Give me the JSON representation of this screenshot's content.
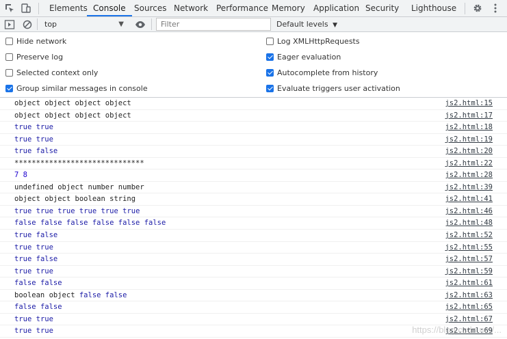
{
  "devtools": {
    "tabs": [
      {
        "label": "Elements"
      },
      {
        "label": "Console",
        "active": true
      },
      {
        "label": "Sources"
      },
      {
        "label": "Network"
      },
      {
        "label": "Performance"
      },
      {
        "label": "Memory"
      },
      {
        "label": "Application"
      },
      {
        "label": "Security"
      },
      {
        "label": "Lighthouse"
      }
    ],
    "accent_color": "#1a73e8"
  },
  "toolbar": {
    "context": "top",
    "filter_placeholder": "Filter",
    "levels_label": "Default levels"
  },
  "settings": {
    "left": [
      {
        "label": "Hide network",
        "checked": false
      },
      {
        "label": "Preserve log",
        "checked": false
      },
      {
        "label": "Selected context only",
        "checked": false
      },
      {
        "label": "Group similar messages in console",
        "checked": true
      }
    ],
    "right": [
      {
        "label": "Log XMLHttpRequests",
        "checked": false
      },
      {
        "label": "Eager evaluation",
        "checked": true
      },
      {
        "label": "Autocomplete from history",
        "checked": true
      },
      {
        "label": "Evaluate triggers user activation",
        "checked": true
      }
    ]
  },
  "console": {
    "messages": [
      {
        "text": "object object object object",
        "source": "js2.html:15"
      },
      {
        "text": "object object object object",
        "source": "js2.html:17"
      },
      {
        "text": "true true",
        "source": "js2.html:18"
      },
      {
        "text": "true true",
        "source": "js2.html:19"
      },
      {
        "text": "true false",
        "source": "js2.html:20"
      },
      {
        "text": "******************************",
        "source": "js2.html:22"
      },
      {
        "text": "7 8",
        "source": "js2.html:28"
      },
      {
        "text": "undefined object number number",
        "source": "js2.html:39"
      },
      {
        "text": "object object boolean string",
        "source": "js2.html:41"
      },
      {
        "text": "true true true true true true",
        "source": "js2.html:46"
      },
      {
        "text": "false false false false false false",
        "source": "js2.html:48"
      },
      {
        "text": "true false",
        "source": "js2.html:52"
      },
      {
        "text": "true true",
        "source": "js2.html:55"
      },
      {
        "text": "true false",
        "source": "js2.html:57"
      },
      {
        "text": "true true",
        "source": "js2.html:59"
      },
      {
        "text": "false false",
        "source": "js2.html:61"
      },
      {
        "text": "boolean object false false",
        "source": "js2.html:63"
      },
      {
        "text": "false false",
        "source": "js2.html:65"
      },
      {
        "text": "true true",
        "source": "js2.html:67"
      },
      {
        "text": "true true",
        "source": "js2.html:69"
      }
    ]
  },
  "watermark": "https://blog.csdn.net/..."
}
